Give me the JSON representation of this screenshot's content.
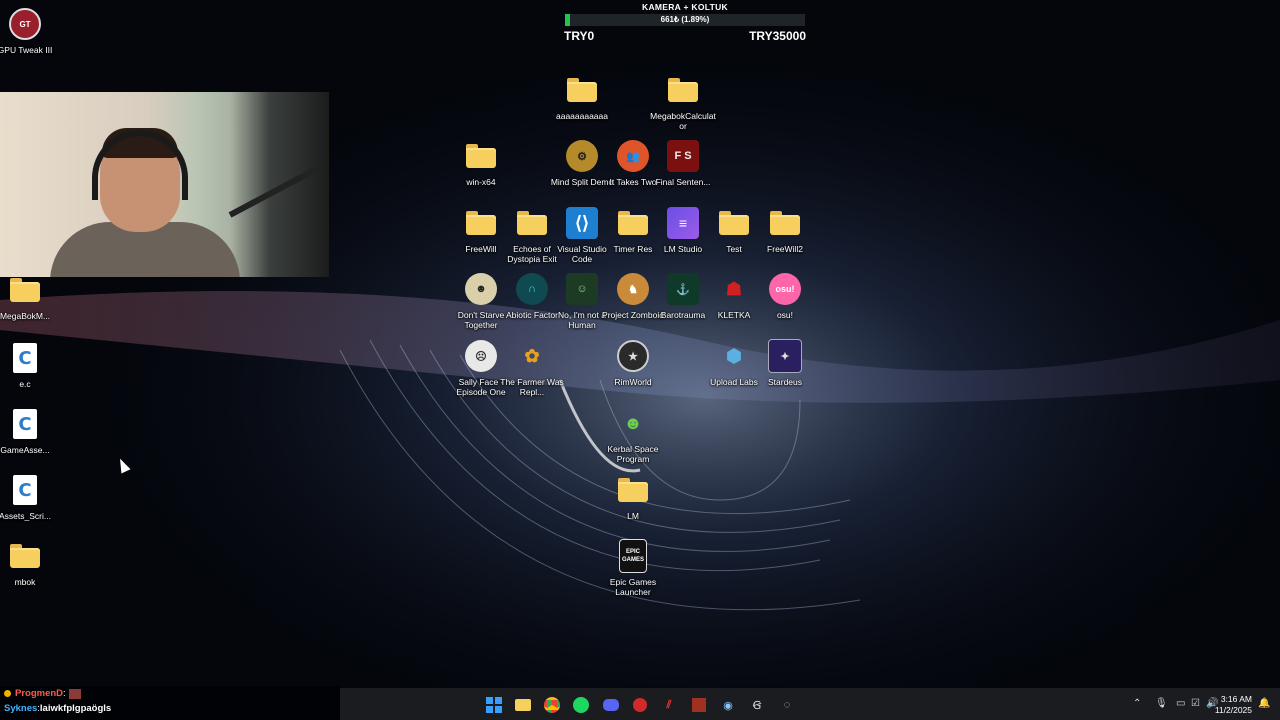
{
  "colors": {
    "folder": "#f6cf5e",
    "taskbar": "#1b1c20",
    "goal_fill": "#27c24a",
    "accent_blue": "#3fb7ff"
  },
  "goal": {
    "title": "KAMERA + KOLTUK",
    "progress_text": "661₺ (1.89%)",
    "progress_percent": 1.89,
    "start_label": "TRY0",
    "end_label": "TRY35000"
  },
  "desktop_left": [
    {
      "label": "GPU Tweak III",
      "icon": "gpu-tweak-icon"
    },
    {
      "label": "MegaBokM...",
      "icon": "folder-icon"
    },
    {
      "label": "e.c",
      "icon": "c-file-icon"
    },
    {
      "label": "GameAsse...",
      "icon": "c-file-icon"
    },
    {
      "label": "Assets_Scri...",
      "icon": "c-file-icon"
    },
    {
      "label": "mbok",
      "icon": "folder-icon"
    }
  ],
  "desktop_grid": [
    {
      "label": "aaaaaaaaaaa",
      "icon": "folder-icon"
    },
    {
      "label": "MegabokCalculator",
      "icon": "folder-icon"
    },
    {
      "label": "win-x64",
      "icon": "folder-icon"
    },
    {
      "label": "Mind Split Demo",
      "icon": "gear-app-icon"
    },
    {
      "label": "It Takes Two",
      "icon": "it-takes-two-icon"
    },
    {
      "label": "Final Senten...",
      "icon": "final-sentence-icon"
    },
    {
      "label": "FreeWill",
      "icon": "folder-icon"
    },
    {
      "label": "Echoes of Dystopia Exit",
      "icon": "folder-icon"
    },
    {
      "label": "Visual Studio Code",
      "icon": "vscode-icon"
    },
    {
      "label": "Timer Res",
      "icon": "folder-icon"
    },
    {
      "label": "LM Studio",
      "icon": "lm-studio-icon"
    },
    {
      "label": "Test",
      "icon": "folder-icon"
    },
    {
      "label": "FreeWill2",
      "icon": "folder-icon"
    },
    {
      "label": "Don't Starve Together",
      "icon": "dont-starve-icon"
    },
    {
      "label": "Abiotic Factor",
      "icon": "abiotic-factor-icon"
    },
    {
      "label": "No, I'm not a Human",
      "icon": "not-human-icon"
    },
    {
      "label": "Project Zomboid",
      "icon": "project-zomboid-icon"
    },
    {
      "label": "Barotrauma",
      "icon": "barotrauma-icon"
    },
    {
      "label": "KLETKA",
      "icon": "kletka-icon"
    },
    {
      "label": "osu!",
      "icon": "osu-icon"
    },
    {
      "label": "Sally Face - Episode One",
      "icon": "sally-face-icon"
    },
    {
      "label": "The Farmer Was Repl...",
      "icon": "farmer-icon"
    },
    {
      "label": "RimWorld",
      "icon": "rimworld-icon"
    },
    {
      "label": "Upload Labs",
      "icon": "upload-labs-icon"
    },
    {
      "label": "Stardeus",
      "icon": "stardeus-icon"
    },
    {
      "label": "Kerbal Space Program",
      "icon": "kerbal-icon"
    },
    {
      "label": "LM",
      "icon": "folder-icon"
    },
    {
      "label": "Epic Games Launcher",
      "icon": "epic-games-icon"
    }
  ],
  "icon_text": {
    "final_sentence": "F S",
    "osu": "osu!",
    "epic": "EPIC GAMES",
    "c_letter": "C"
  },
  "chat": [
    {
      "user": "ProgmenD",
      "message": ""
    },
    {
      "user": "Syknes",
      "message": "laiwkfplgpaögls"
    }
  ],
  "chat_sep": ": ",
  "taskbar": {
    "apps": [
      "windows-start-icon",
      "file-explorer-icon",
      "chrome-icon",
      "spotify-icon",
      "discord-icon",
      "app-red-icon",
      "app-slash-icon",
      "app-bonk-icon",
      "steam-icon",
      "app-g-icon",
      "app-circle-icon"
    ],
    "tray": [
      "chevron-up-icon",
      "mic-icon",
      "network-icon",
      "shield-check-icon",
      "volume-icon"
    ],
    "time": "3:16 AM",
    "date": "11/2/2025"
  }
}
